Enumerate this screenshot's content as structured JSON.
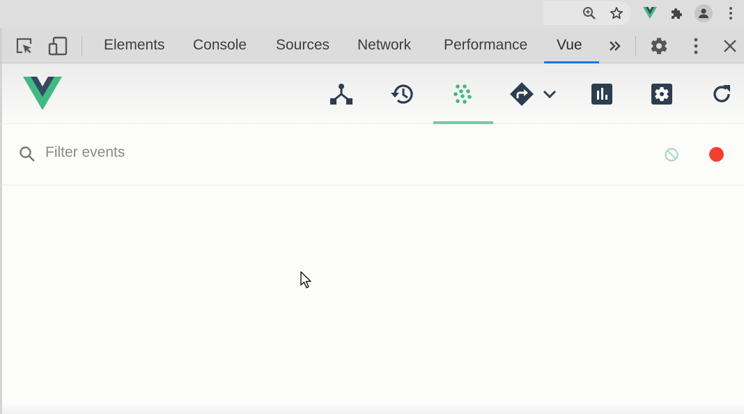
{
  "browser_toolbar": {
    "icons": [
      "zoom-icon",
      "bookmark-star-icon",
      "vue-extension-icon",
      "extensions-puzzle-icon",
      "profile-avatar-icon",
      "more-vert-icon"
    ]
  },
  "devtools": {
    "tabs": [
      {
        "label": "Elements",
        "active": false
      },
      {
        "label": "Console",
        "active": false
      },
      {
        "label": "Sources",
        "active": false
      },
      {
        "label": "Network",
        "active": false
      },
      {
        "label": "Performance",
        "active": false
      },
      {
        "label": "Vue",
        "active": true
      }
    ],
    "overflow_label": "»",
    "accent": "#1a73e8"
  },
  "vue_devtools": {
    "toolbar_icons": [
      {
        "name": "components",
        "active": false
      },
      {
        "name": "vuex-timeline",
        "active": false
      },
      {
        "name": "events",
        "active": true
      },
      {
        "name": "routing",
        "active": false
      },
      {
        "name": "performance",
        "active": false
      },
      {
        "name": "settings",
        "active": false
      },
      {
        "name": "refresh",
        "active": false
      }
    ],
    "accent": "#42b883",
    "dark": "#2c3e50"
  },
  "events_panel": {
    "filter": {
      "placeholder": "Filter events",
      "value": ""
    },
    "recording": true,
    "record_color": "#f2402f"
  }
}
